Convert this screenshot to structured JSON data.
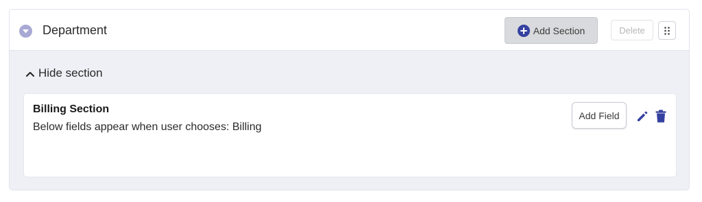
{
  "header": {
    "title": "Department",
    "add_section_label": "Add Section",
    "delete_label": "Delete",
    "collapse_icon": "chevron-down-icon",
    "add_icon": "plus-circle-icon",
    "drag_icon": "drag-handle-icon"
  },
  "toggle": {
    "label": "Hide section",
    "icon": "chevron-up-icon"
  },
  "section": {
    "title": "Billing Section",
    "description": "Below fields appear when user chooses: Billing",
    "add_field_label": "Add Field",
    "edit_icon": "pencil-icon",
    "delete_icon": "trash-icon"
  },
  "colors": {
    "accent": "#3541a0",
    "toggle_circle": "#a8a9d4",
    "panel_bg": "#eef0f6"
  }
}
